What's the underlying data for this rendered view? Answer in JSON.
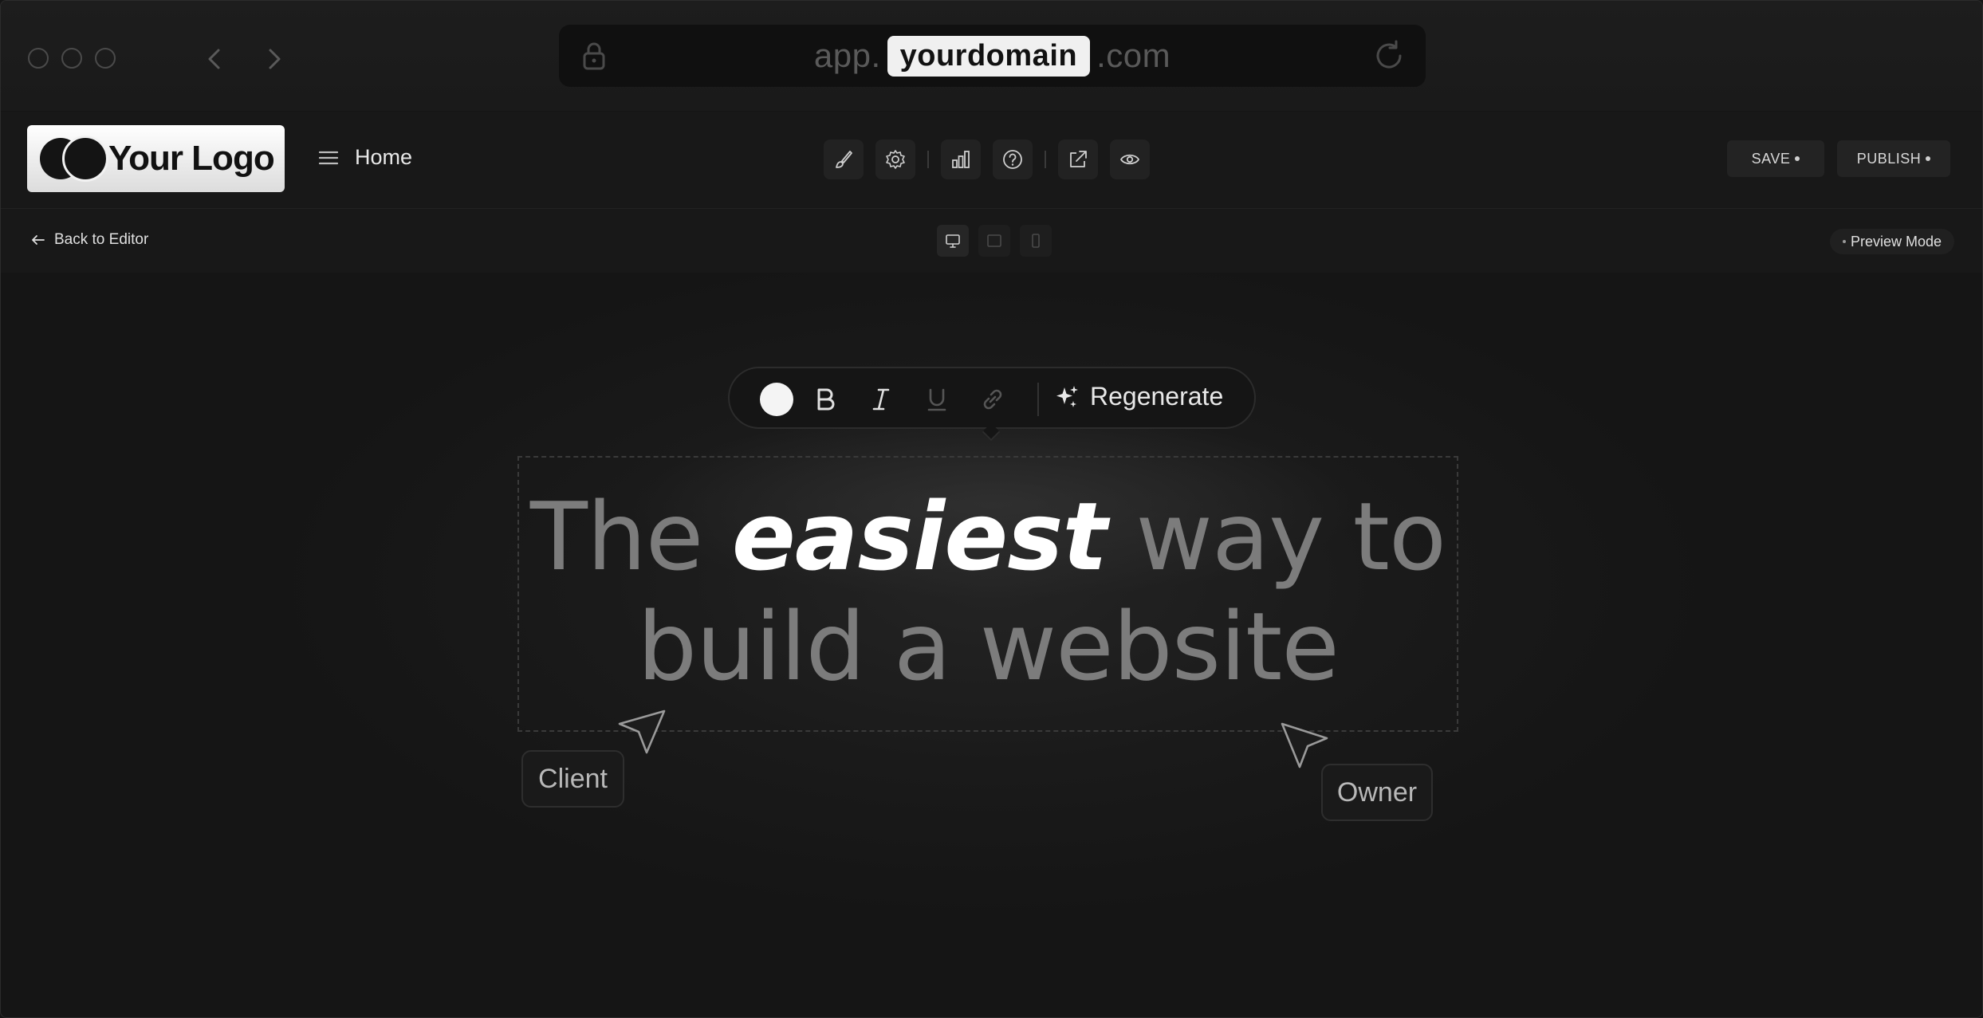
{
  "browser": {
    "url_prefix": "app.",
    "url_domain": "yourdomain",
    "url_suffix": ".com"
  },
  "header": {
    "logo_text": "Your Logo",
    "menu_label": "Home",
    "save_label": "SAVE",
    "publish_label": "PUBLISH",
    "tools": [
      "brush-icon",
      "gear-icon",
      "bar-chart-icon",
      "help-icon",
      "external-link-icon",
      "eye-icon"
    ]
  },
  "subbar": {
    "back_label": "Back to Editor",
    "preview_label": "Preview Mode",
    "devices": [
      "desktop-icon",
      "tablet-icon",
      "mobile-icon"
    ]
  },
  "editor_toolbar": {
    "swatch_color": "#f4f4f4",
    "bold": "B",
    "regenerate_label": "Regenerate"
  },
  "headline": {
    "part1": "The ",
    "emphasis": "easiest",
    "part2": " way to",
    "line2": "build a website"
  },
  "collaborators": {
    "client_label": "Client",
    "owner_label": "Owner"
  },
  "colors": {
    "background": "#151515",
    "accent": "#ffffff"
  }
}
